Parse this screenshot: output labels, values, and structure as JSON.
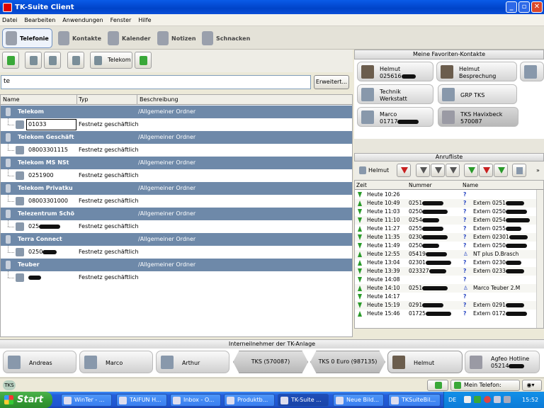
{
  "window": {
    "title": "TK-Suite Client",
    "buttons": [
      "_",
      "▫",
      "✕"
    ]
  },
  "menu": [
    "Datei",
    "Bearbeiten",
    "Anwendungen",
    "Fenster",
    "Hilfe"
  ],
  "tabs": [
    {
      "label": "Telefonie",
      "active": true
    },
    {
      "label": "Kontakte"
    },
    {
      "label": "Kalender"
    },
    {
      "label": "Notizen"
    },
    {
      "label": "Schnacken"
    }
  ],
  "toolbar": {
    "provider_label": "Telekom"
  },
  "search": {
    "value": "te",
    "button": "Erweitert..."
  },
  "contacts": {
    "columns": [
      "Name",
      "Typ",
      "Beschreibung"
    ],
    "groups": [
      {
        "name": "Telekom",
        "desc": "/Allgemeiner Ordner",
        "number": "01033",
        "type": "Festnetz geschäftlich"
      },
      {
        "name": "Telekom Geschäft",
        "desc": "/Allgemeiner Ordner",
        "number": "08003301115",
        "type": "Festnetz geschäftlich"
      },
      {
        "name": "Telekom MS NSt",
        "desc": "/Allgemeiner Ordner",
        "number": "0251900",
        "type": "Festnetz geschäftlich"
      },
      {
        "name": "Telekom Privatku",
        "desc": "/Allgemeiner Ordner",
        "number": "08003301000",
        "type": "Festnetz geschäftlich"
      },
      {
        "name": "Telezentrum Schö",
        "desc": "/Allgemeiner Ordner",
        "number": "025",
        "type": "Festnetz geschäftlich"
      },
      {
        "name": "Terra Connect",
        "desc": "/Allgemeiner Ordner",
        "number": "0250",
        "type": "Festnetz geschäftlich"
      },
      {
        "name": "Teuber",
        "desc": "/Allgemeiner Ordner",
        "number": "",
        "type": "Festnetz geschäftlich"
      }
    ]
  },
  "favorites": {
    "title": "Meine Favoriten-Kontakte",
    "items": [
      {
        "line1": "Helmut",
        "line2": "025616"
      },
      {
        "line1": "Helmut",
        "line2": "Besprechung"
      },
      {
        "line1": "Technik",
        "line2": "Werkstatt"
      },
      {
        "line1": "GRP TKS",
        "line2": ""
      },
      {
        "line1": "Marco",
        "line2": "01717"
      },
      {
        "line1": "TKS Havixbeck",
        "line2": "570087"
      }
    ]
  },
  "calls": {
    "title": "Anrufliste",
    "user": "Helmut",
    "columns": [
      "Zeit",
      "Nummer",
      "Name"
    ],
    "rows": [
      {
        "time": "Heute 10:26",
        "num": "",
        "name": ""
      },
      {
        "time": "Heute 10:49",
        "num": "0251",
        "name": "Extern 0251"
      },
      {
        "time": "Heute 11:03",
        "num": "0250",
        "name": "Extern 0250"
      },
      {
        "time": "Heute 11:10",
        "num": "0254",
        "name": "Extern 0254"
      },
      {
        "time": "Heute 11:27",
        "num": "0255",
        "name": "Extern 0255"
      },
      {
        "time": "Heute 11:35",
        "num": "0230",
        "name": "Extern 02301"
      },
      {
        "time": "Heute 11:49",
        "num": "0250",
        "name": "Extern 0250"
      },
      {
        "time": "Heute 12:55",
        "num": "05419",
        "name": "NT plus D.Brasch"
      },
      {
        "time": "Heute 13:04",
        "num": "02301",
        "name": "Extern 0230"
      },
      {
        "time": "Heute 13:39",
        "num": "023327",
        "name": "Extern 0233"
      },
      {
        "time": "Heute 14:08",
        "num": "",
        "name": ""
      },
      {
        "time": "Heute 14:10",
        "num": "0251",
        "name": "Marco Teuber 2.M"
      },
      {
        "time": "Heute 14:17",
        "num": "",
        "name": ""
      },
      {
        "time": "Heute 15:19",
        "num": "0291",
        "name": "Extern 0291"
      },
      {
        "time": "Heute 15:46",
        "num": "01725",
        "name": "Extern 0172"
      }
    ]
  },
  "internal": {
    "title": "Interneilnehmer der TK-Anlage",
    "items": [
      "Andreas",
      "Marco",
      "Arthur",
      "TKS (570087)",
      "TKS 0 Euro (987135)",
      "Helmut"
    ],
    "hotline": {
      "line1": "Agfeo Hotline",
      "line2": "05214"
    }
  },
  "status": {
    "badge": "TKS",
    "phone": "Mein Telefon: Helmut"
  },
  "taskbar": {
    "start": "Start",
    "tasks": [
      "WinTer - ...",
      "TAIFUN H...",
      "Inbox - O...",
      "Produktb...",
      "TK-Suite ...",
      "Neue Bild...",
      "TKSuiteBil..."
    ],
    "lang": "DE",
    "clock": "15:52"
  }
}
